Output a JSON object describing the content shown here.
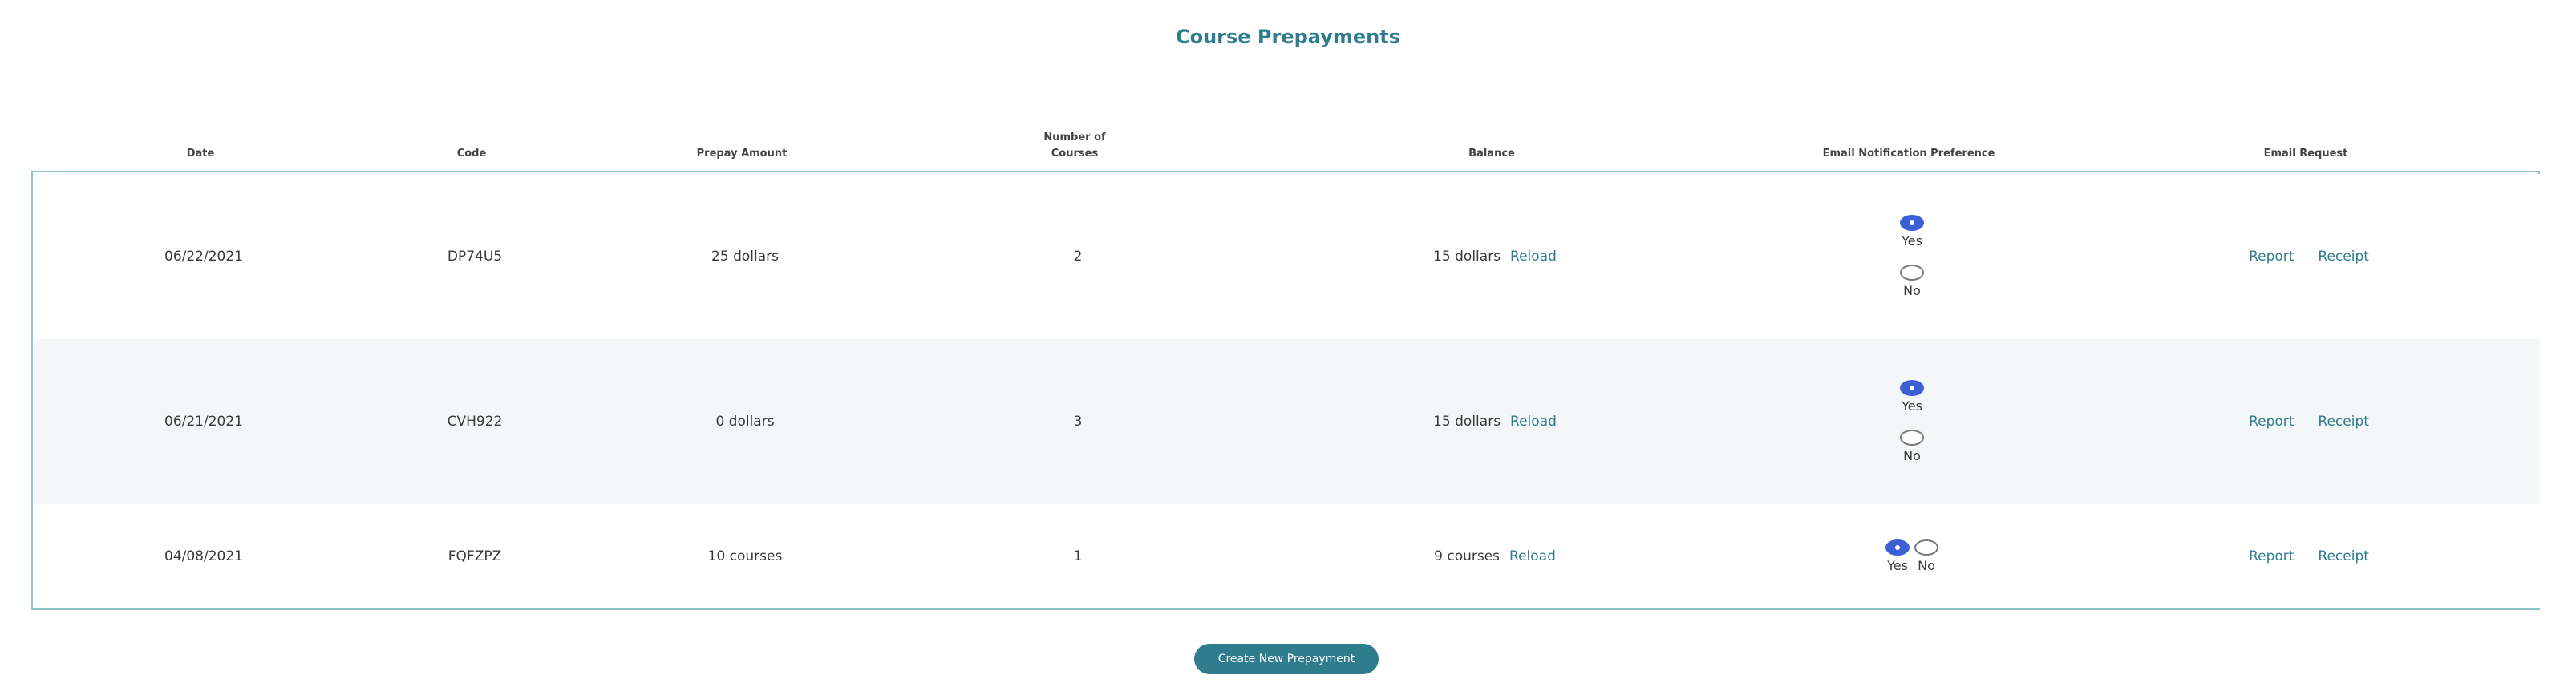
{
  "page": {
    "title": "Course Prepayments"
  },
  "table": {
    "headers": {
      "date": "Date",
      "code": "Code",
      "prepay_amount": "Prepay Amount",
      "number_of_courses": "Number of\nCourses",
      "balance": "Balance",
      "email_pref": "Email Notification Preference",
      "email_request": "Email Request"
    },
    "rows": [
      {
        "date": "06/22/2021",
        "code": "DP74U5",
        "prepay_amount": "25 dollars",
        "courses": "2",
        "balance": "15 dollars",
        "reload_label": "Reload",
        "pref": {
          "yes_label": "Yes",
          "no_label": "No",
          "selected": "Yes"
        },
        "report_label": "Report",
        "receipt_label": "Receipt"
      },
      {
        "date": "06/21/2021",
        "code": "CVH922",
        "prepay_amount": "0 dollars",
        "courses": "3",
        "balance": "15 dollars",
        "reload_label": "Reload",
        "pref": {
          "yes_label": "Yes",
          "no_label": "No",
          "selected": "Yes"
        },
        "report_label": "Report",
        "receipt_label": "Receipt"
      },
      {
        "date": "04/08/2021",
        "code": "FQFZPZ",
        "prepay_amount": "10 courses",
        "courses": "1",
        "balance": "9 courses",
        "reload_label": "Reload",
        "pref": {
          "yes_label": "Yes",
          "no_label": "No",
          "selected": "Yes"
        },
        "report_label": "Report",
        "receipt_label": "Receipt"
      }
    ]
  },
  "actions": {
    "create_label": "Create New Prepayment"
  },
  "colors": {
    "accent": "#2f7c8e",
    "radio_selected": "#3c5fd6",
    "table_border": "#8fc3cc",
    "alt_row": "#f3f7f7"
  }
}
